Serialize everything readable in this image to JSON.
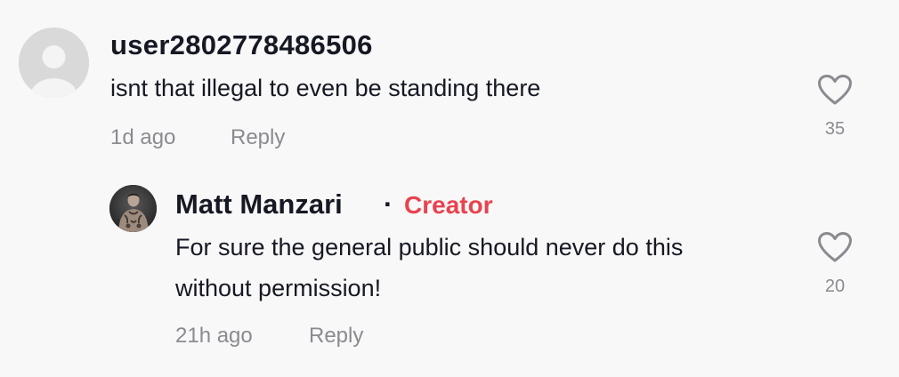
{
  "comment": {
    "username": "user2802778486506",
    "text": "isnt that illegal to even be standing there",
    "timestamp": "1d ago",
    "reply_label": "Reply",
    "like_count": "35",
    "avatar_icon": "default-user-icon",
    "like_icon": "heart-outline-icon"
  },
  "reply": {
    "username": "Matt Manzari",
    "separator": "·",
    "badge": "Creator",
    "text_line1": "For sure the general public should never do this",
    "text_line2": "without permission!",
    "timestamp": "21h ago",
    "reply_label": "Reply",
    "like_count": "20",
    "avatar_icon": "profile-photo",
    "like_icon": "heart-outline-icon"
  },
  "colors": {
    "background": "#f8f8f8",
    "primary_text": "#161823",
    "secondary_text": "#8a8b91",
    "creator_badge": "#e8434f",
    "default_avatar": "#d9d9d9"
  }
}
